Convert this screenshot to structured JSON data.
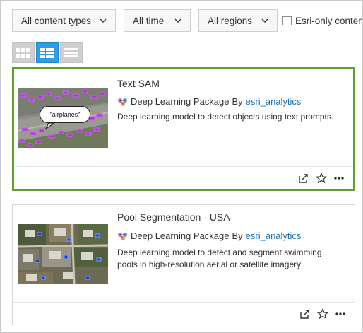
{
  "filters": {
    "content_types": "All content types",
    "time": "All time",
    "regions": "All regions",
    "esri_only": "Esri-only content"
  },
  "view_modes": [
    {
      "name": "grid-view",
      "active": false
    },
    {
      "name": "table-view",
      "active": true
    },
    {
      "name": "list-view",
      "active": false
    }
  ],
  "items": [
    {
      "title": "Text SAM",
      "type": "Deep Learning Package",
      "by": "By",
      "owner": "esri_analytics",
      "description": "Deep learning model to detect objects using text prompts.",
      "thumbnail_label": "\"airplanes\"",
      "selected": true
    },
    {
      "title": "Pool Segmentation - USA",
      "type": "Deep Learning Package",
      "by": "By",
      "owner": "esri_analytics",
      "description_line1": "Deep learning model to detect and segment swimming",
      "description_line2": "pools in high-resolution aerial or satellite imagery.",
      "selected": false
    }
  ],
  "colors": {
    "selected_border": "#5ea02f",
    "active_view": "#2f9ee6",
    "link": "#1773b8"
  },
  "icons": {
    "share": "share-icon",
    "favorite": "star-icon",
    "more": "more-options-icon",
    "package": "deep-learning-package-icon",
    "chevron": "chevron-down-icon"
  }
}
